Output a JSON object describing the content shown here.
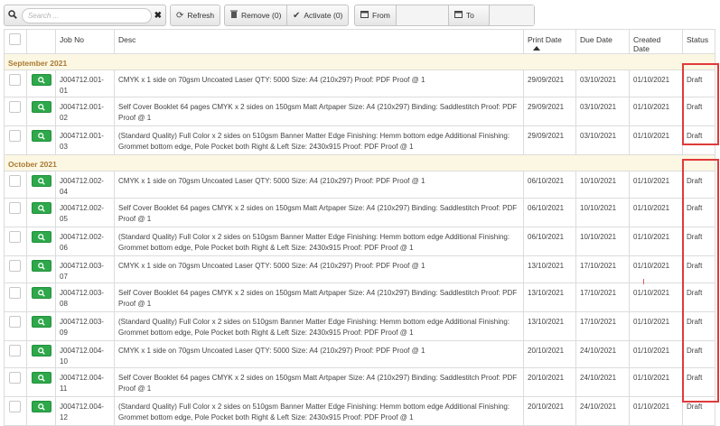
{
  "toolbar": {
    "search_placeholder": "Search ...",
    "refresh_label": "Refresh",
    "remove_label": "Remove (0)",
    "activate_label": "Activate (0)",
    "from_label": "From",
    "to_label": "To"
  },
  "columns": {
    "job_no": "Job No",
    "desc": "Desc",
    "print_date": "Print Date",
    "due_date": "Due Date",
    "created_date": "Created Date",
    "status": "Status"
  },
  "groups": [
    {
      "label": "September 2021",
      "rows": [
        {
          "job_no": "J004712.001-01",
          "desc": "CMYK x 1 side on 70gsm Uncoated Laser QTY: 5000 Size: A4 (210x297) Proof: PDF Proof @ 1",
          "print_date": "29/09/2021",
          "due_date": "03/10/2021",
          "created_date": "01/10/2021",
          "status": "Draft"
        },
        {
          "job_no": "J004712.001-02",
          "desc": "Self Cover Booklet 64 pages CMYK x 2 sides on 150gsm Matt Artpaper Size: A4 (210x297) Binding: Saddlestitch Proof: PDF Proof @ 1",
          "print_date": "29/09/2021",
          "due_date": "03/10/2021",
          "created_date": "01/10/2021",
          "status": "Draft"
        },
        {
          "job_no": "J004712.001-03",
          "desc": "(Standard Quality) Full Color x 2 sides on 510gsm Banner Matter Edge Finishing: Hemm bottom edge Additional Finishing: Grommet bottom edge, Pole Pocket both Right & Left Size: 2430x915 Proof: PDF Proof @ 1",
          "print_date": "29/09/2021",
          "due_date": "03/10/2021",
          "created_date": "01/10/2021",
          "status": "Draft"
        }
      ]
    },
    {
      "label": "October 2021",
      "rows": [
        {
          "job_no": "J004712.002-04",
          "desc": "CMYK x 1 side on 70gsm Uncoated Laser QTY: 5000 Size: A4 (210x297) Proof: PDF Proof @ 1",
          "print_date": "06/10/2021",
          "due_date": "10/10/2021",
          "created_date": "01/10/2021",
          "status": "Draft"
        },
        {
          "job_no": "J004712.002-05",
          "desc": "Self Cover Booklet 64 pages CMYK x 2 sides on 150gsm Matt Artpaper Size: A4 (210x297) Binding: Saddlestitch Proof: PDF Proof @ 1",
          "print_date": "06/10/2021",
          "due_date": "10/10/2021",
          "created_date": "01/10/2021",
          "status": "Draft"
        },
        {
          "job_no": "J004712.002-06",
          "desc": "(Standard Quality) Full Color x 2 sides on 510gsm Banner Matter Edge Finishing: Hemm bottom edge Additional Finishing: Grommet bottom edge, Pole Pocket both Right & Left Size: 2430x915 Proof: PDF Proof @ 1",
          "print_date": "06/10/2021",
          "due_date": "10/10/2021",
          "created_date": "01/10/2021",
          "status": "Draft"
        },
        {
          "job_no": "J004712.003-07",
          "desc": "CMYK x 1 side on 70gsm Uncoated Laser QTY: 5000 Size: A4 (210x297) Proof: PDF Proof @ 1",
          "print_date": "13/10/2021",
          "due_date": "17/10/2021",
          "created_date": "01/10/2021",
          "status": "Draft"
        },
        {
          "job_no": "J004712.003-08",
          "desc": "Self Cover Booklet 64 pages CMYK x 2 sides on 150gsm Matt Artpaper Size: A4 (210x297) Binding: Saddlestitch Proof: PDF Proof @ 1",
          "print_date": "13/10/2021",
          "due_date": "17/10/2021",
          "created_date": "01/10/2021",
          "status": "Draft"
        },
        {
          "job_no": "J004712.003-09",
          "desc": "(Standard Quality) Full Color x 2 sides on 510gsm Banner Matter Edge Finishing: Hemm bottom edge Additional Finishing: Grommet bottom edge, Pole Pocket both Right & Left Size: 2430x915 Proof: PDF Proof @ 1",
          "print_date": "13/10/2021",
          "due_date": "17/10/2021",
          "created_date": "01/10/2021",
          "status": "Draft"
        },
        {
          "job_no": "J004712.004-10",
          "desc": "CMYK x 1 side on 70gsm Uncoated Laser QTY: 5000 Size: A4 (210x297) Proof: PDF Proof @ 1",
          "print_date": "20/10/2021",
          "due_date": "24/10/2021",
          "created_date": "01/10/2021",
          "status": "Draft"
        },
        {
          "job_no": "J004712.004-11",
          "desc": "Self Cover Booklet 64 pages CMYK x 2 sides on 150gsm Matt Artpaper Size: A4 (210x297) Binding: Saddlestitch Proof: PDF Proof @ 1",
          "print_date": "20/10/2021",
          "due_date": "24/10/2021",
          "created_date": "01/10/2021",
          "status": "Draft"
        },
        {
          "job_no": "J004712.004-12",
          "desc": "(Standard Quality) Full Color x 2 sides on 510gsm Banner Matter Edge Finishing: Hemm bottom edge Additional Finishing: Grommet bottom edge, Pole Pocket both Right & Left Size: 2430x915 Proof: PDF Proof @ 1",
          "print_date": "20/10/2021",
          "due_date": "24/10/2021",
          "created_date": "01/10/2021",
          "status": "Draft"
        }
      ]
    }
  ],
  "colors": {
    "group_bg": "#fcf7e3",
    "group_text": "#a97a33",
    "view_button": "#2ea84a",
    "highlight": "#e03a3a"
  },
  "icons": [
    "search-icon",
    "clear-icon",
    "refresh-icon",
    "trash-icon",
    "check-icon",
    "calendar-icon",
    "sort-asc-icon",
    "magnifier-icon"
  ]
}
